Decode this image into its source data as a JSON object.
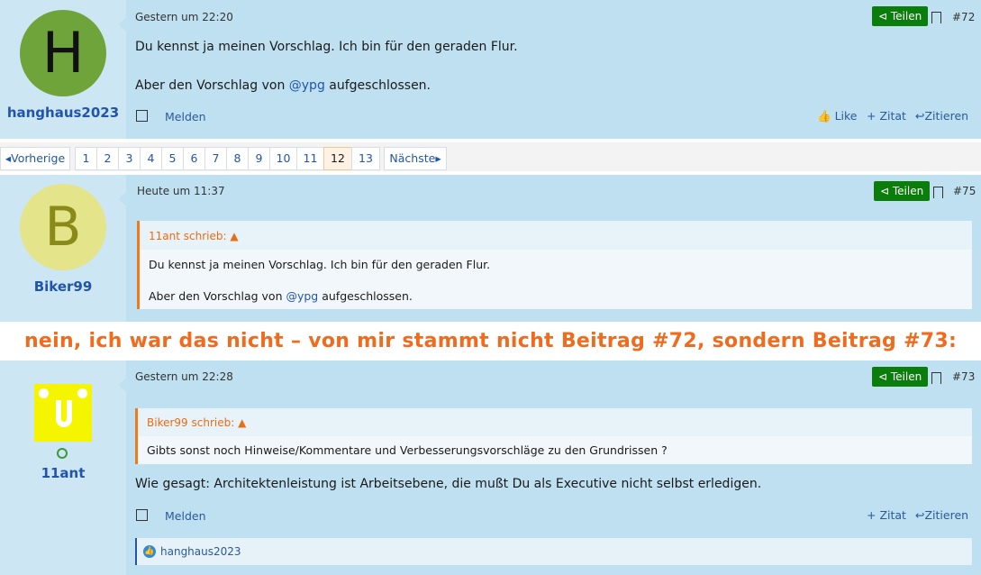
{
  "posts": [
    {
      "username": "hanghaus2023",
      "avatar_letter": "H",
      "avatar_color": "#6fa43a",
      "date": "Gestern um 22:20",
      "share_label": "Teilen",
      "post_number": "#72",
      "lines": [
        "Du kennst ja meinen Vorschlag. Ich bin für den geraden Flur."
      ],
      "line2_before": "Aber den Vorschlag von ",
      "line2_mention": "@ypg",
      "line2_after": " aufgeschlossen.",
      "report_label": "Melden",
      "like_label": "Like",
      "quote_label": "+ Zitat",
      "reply_label": "Zitieren"
    },
    {
      "username": "Biker99",
      "avatar_letter": "B",
      "avatar_color": "#e4e48a",
      "date": "Heute um 11:37",
      "share_label": "Teilen",
      "post_number": "#75",
      "quote_author": "11ant schrieb:",
      "quote_line1": "Du kennst ja meinen Vorschlag. Ich bin für den geraden Flur.",
      "quote_line2_before": "Aber den Vorschlag von ",
      "quote_line2_mention": "@ypg",
      "quote_line2_after": " aufgeschlossen."
    },
    {
      "username": "11ant",
      "date": "Gestern um 22:28",
      "share_label": "Teilen",
      "post_number": "#73",
      "quote_author": "Biker99 schrieb:",
      "quote_line1": "Gibts sonst noch Hinweise/Kommentare und Verbesserungsvorschläge zu den Grundrissen ?",
      "body": "Wie gesagt: Architektenleistung ist Arbeitsebene, die mußt Du als Executive nicht selbst erledigen.",
      "report_label": "Melden",
      "quote_label": "+ Zitat",
      "reply_label": "Zitieren",
      "reaction_user": "hanghaus2023"
    }
  ],
  "pagination": {
    "prev": "Vorherige",
    "pages": [
      "1",
      "2",
      "3",
      "4",
      "5",
      "6",
      "7",
      "8",
      "9",
      "10",
      "11",
      "12",
      "13"
    ],
    "current": "12",
    "next": "Nächste"
  },
  "banner": "nein, ich war das nicht – von mir stammt nicht Beitrag #72, sondern Beitrag #73:",
  "colors": {
    "share_green": "#0a7d0a",
    "accent_orange": "#f26a1b",
    "link_blue": "#2255aa"
  }
}
